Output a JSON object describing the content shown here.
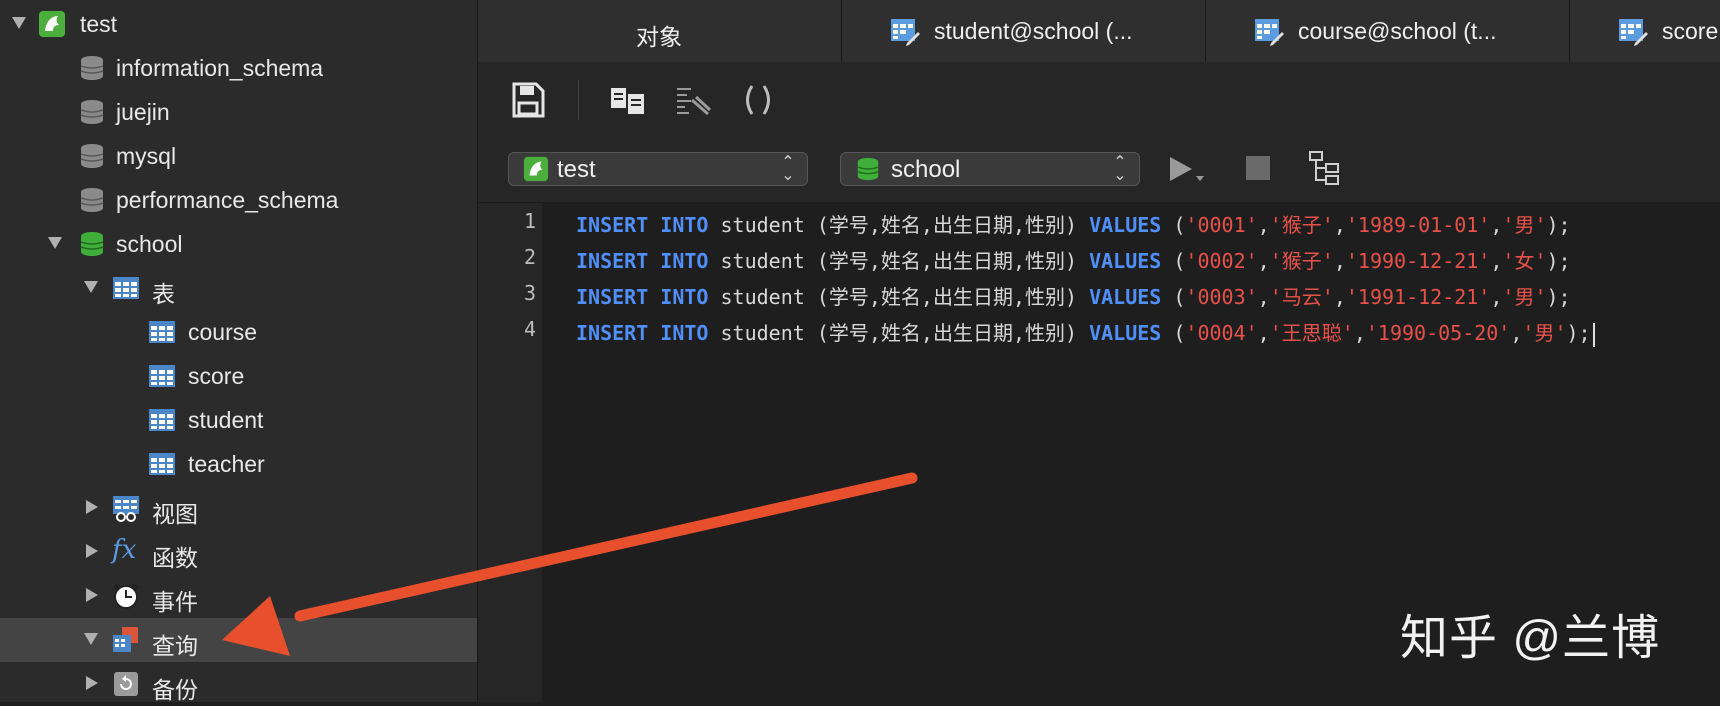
{
  "sidebar": {
    "connection": {
      "label": "test",
      "icon": "dolphin-icon"
    },
    "databases": [
      {
        "label": "information_schema",
        "icon": "database-gray-icon"
      },
      {
        "label": "juejin",
        "icon": "database-gray-icon"
      },
      {
        "label": "mysql",
        "icon": "database-gray-icon"
      },
      {
        "label": "performance_schema",
        "icon": "database-gray-icon"
      },
      {
        "label": "school",
        "icon": "database-green-icon"
      }
    ],
    "groups": {
      "tables": {
        "label": "表",
        "items": [
          "course",
          "score",
          "student",
          "teacher"
        ]
      },
      "views": {
        "label": "视图"
      },
      "functions": {
        "label": "函数",
        "icon_text": "fx"
      },
      "events": {
        "label": "事件"
      },
      "queries": {
        "label": "查询"
      },
      "backups": {
        "label": "备份"
      }
    }
  },
  "tabs": [
    {
      "label": "对象"
    },
    {
      "label": "student@school (..."
    },
    {
      "label": "course@school (t..."
    },
    {
      "label": "score"
    }
  ],
  "selectors": {
    "connection": "test",
    "database": "school",
    "arrows": "⌃⌄"
  },
  "editor": {
    "line_numbers": [
      "1",
      "2",
      "3",
      "4"
    ],
    "lines": [
      {
        "kw1": "INSERT INTO",
        "mid": " student (学号,姓名,出生日期,性别) ",
        "kw2": "VALUES",
        "open": " (",
        "v1": "'0001'",
        "v2": "'猴子'",
        "v3": "'1989-01-01'",
        "v4": "'男'",
        "close": ");",
        "comma": ","
      },
      {
        "kw1": "INSERT INTO",
        "mid": " student (学号,姓名,出生日期,性别) ",
        "kw2": "VALUES",
        "open": " (",
        "v1": "'0002'",
        "v2": "'猴子'",
        "v3": "'1990-12-21'",
        "v4": "'女'",
        "close": ");",
        "comma": ","
      },
      {
        "kw1": "INSERT INTO",
        "mid": " student (学号,姓名,出生日期,性别) ",
        "kw2": "VALUES",
        "open": " (",
        "v1": "'0003'",
        "v2": "'马云'",
        "v3": "'1991-12-21'",
        "v4": "'男'",
        "close": ");",
        "comma": ","
      },
      {
        "kw1": "INSERT INTO",
        "mid": " student (学号,姓名,出生日期,性别) ",
        "kw2": "VALUES",
        "open": " (",
        "v1": "'0004'",
        "v2": "'王思聪'",
        "v3": "'1990-05-20'",
        "v4": "'男'",
        "close": ");",
        "comma": ","
      }
    ]
  },
  "watermark": "知乎 @兰博",
  "colors": {
    "keyword": "#4f8ff7",
    "string": "#e8514a",
    "arrow": "#e8502d",
    "selection": "#444444"
  }
}
